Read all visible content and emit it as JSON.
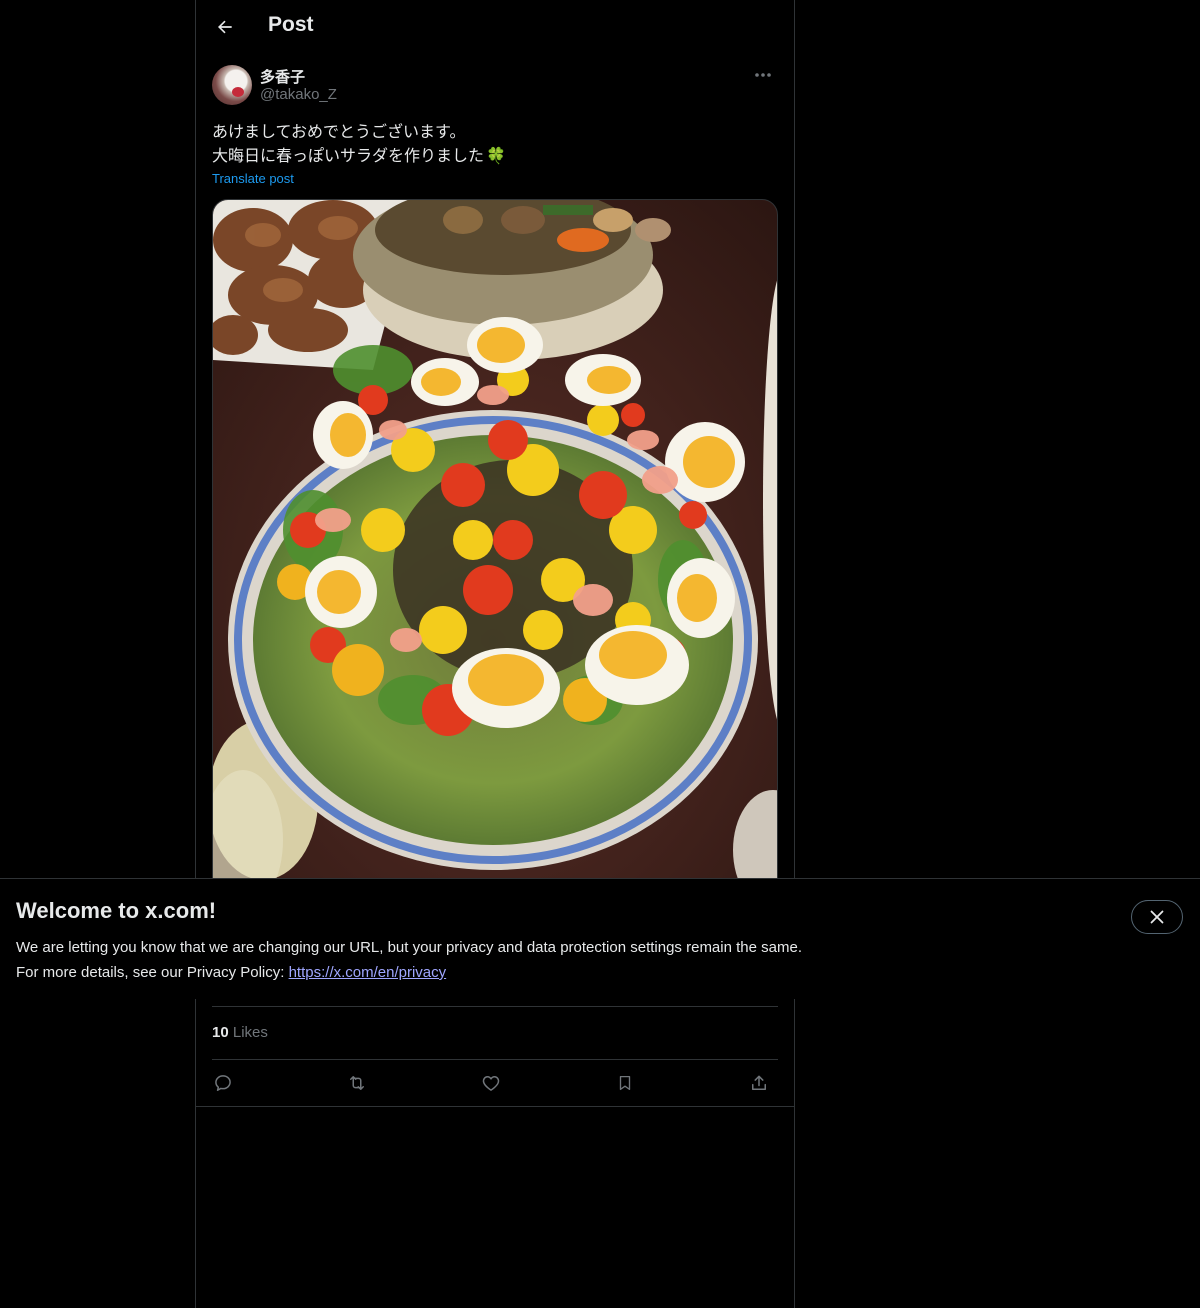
{
  "header": {
    "title": "Post"
  },
  "post": {
    "author_name": "多香子",
    "author_handle": "@takako_Z",
    "text_line1": "あけましておめでとうございます。",
    "text_line2": "大晦日に春っぽいサラダを作りました",
    "text_emoji": "🍀",
    "translate_label": "Translate post",
    "likes_count": "10",
    "likes_label": "Likes"
  },
  "banner": {
    "title": "Welcome to x.com!",
    "line1": "We are letting you know that we are changing our URL, but your privacy and data protection settings remain the same.",
    "line2_prefix": "For more details, see our Privacy Policy: ",
    "privacy_link": "https://x.com/en/privacy"
  },
  "icons": {
    "back": "arrow-left-icon",
    "more": "more-horizontal-icon",
    "reply": "reply-icon",
    "repost": "repost-icon",
    "like": "heart-icon",
    "bookmark": "bookmark-icon",
    "share": "share-icon",
    "close": "close-icon"
  },
  "colors": {
    "background": "#000000",
    "text": "#e7e9ea",
    "secondary": "#71767b",
    "link": "#1d9bf0",
    "border": "#2f3336"
  }
}
